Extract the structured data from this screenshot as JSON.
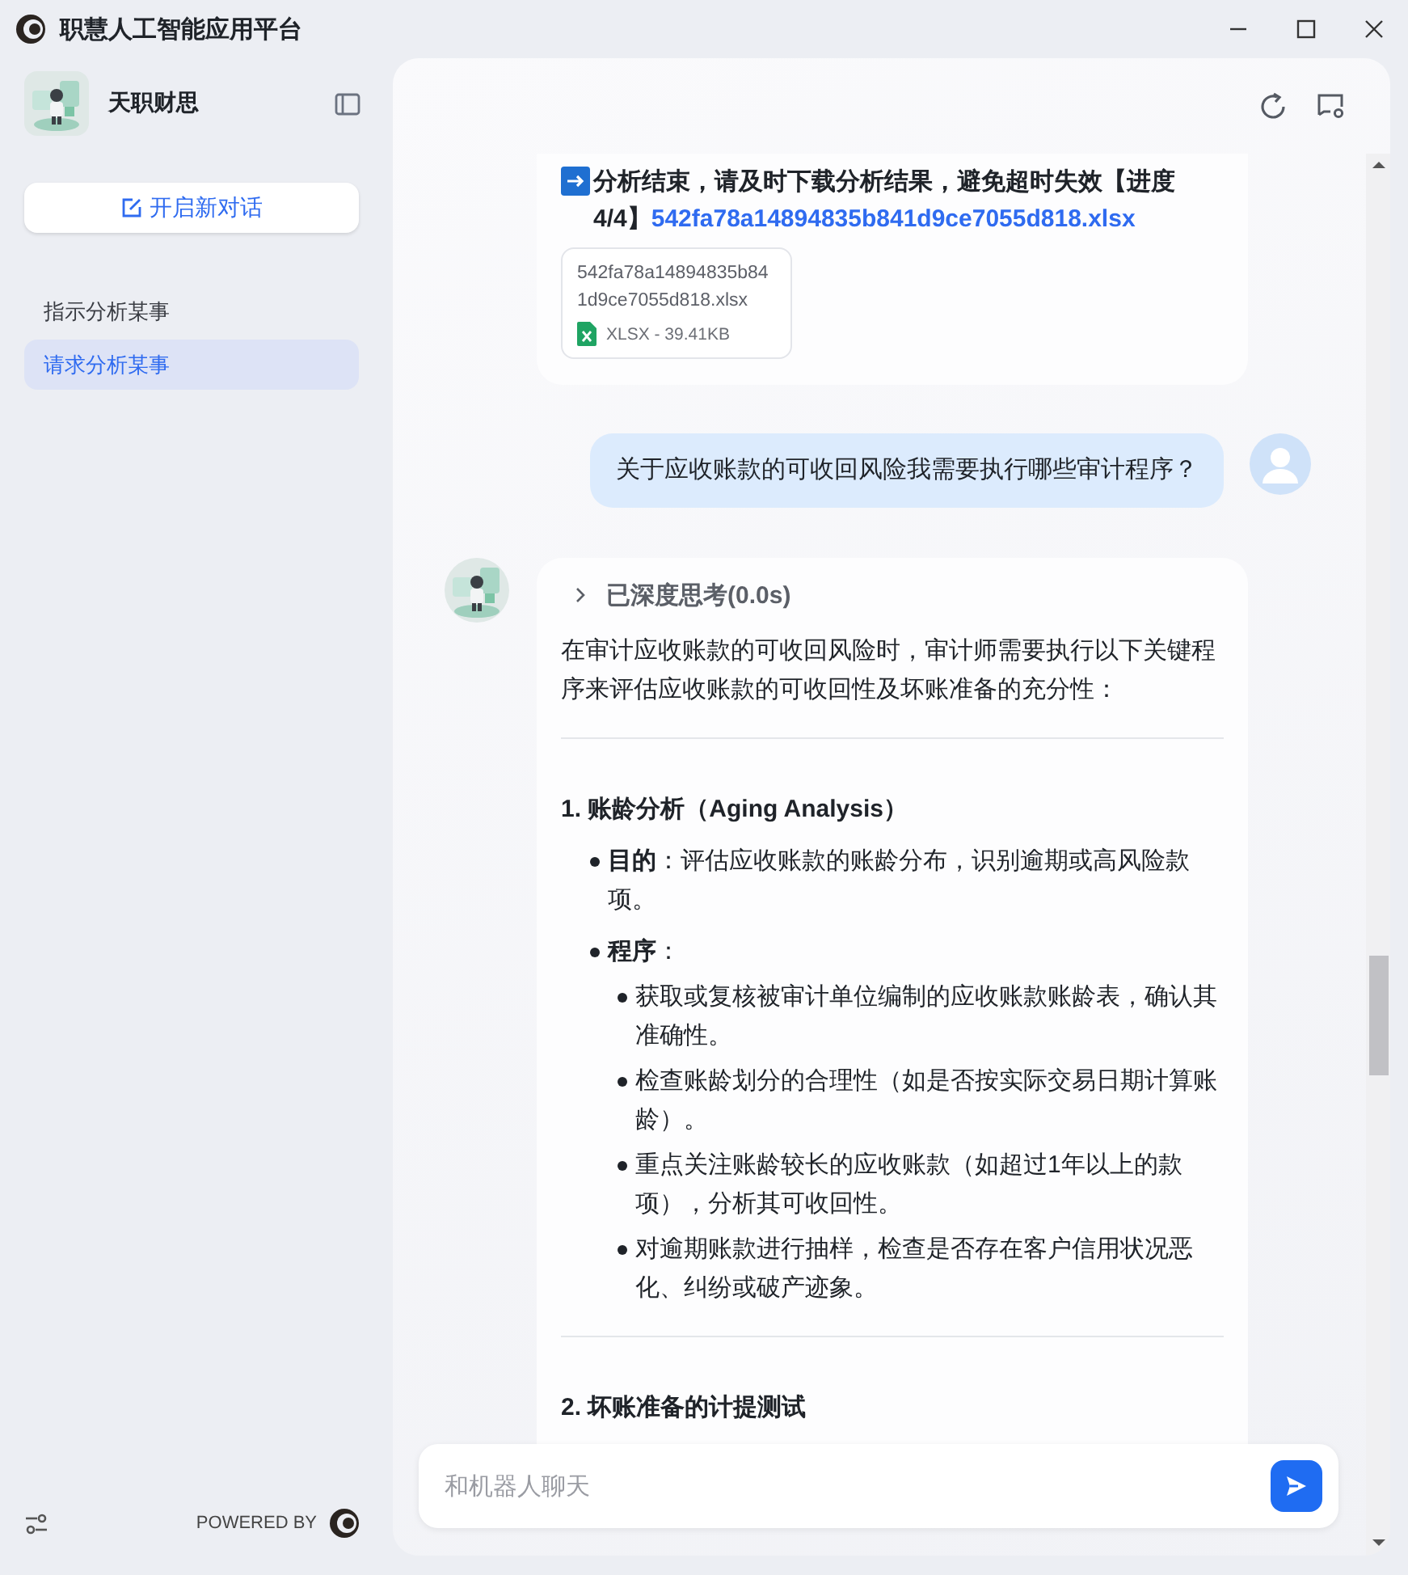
{
  "window": {
    "title": "职慧人工智能应用平台"
  },
  "sidebar": {
    "bot_name": "天职财思",
    "new_chat": "开启新对话",
    "conversations": [
      {
        "label": "指示分析某事",
        "selected": false
      },
      {
        "label": "请求分析某事",
        "selected": true
      }
    ],
    "powered_by": "POWERED BY"
  },
  "messages": [
    {
      "kind": "file_result",
      "text": "分析结束，请及时下载分析结果，避免超时失效【进度4/4】",
      "link": "542fa78a14894835b841d9ce7055d818.xlsx",
      "file": {
        "name": "542fa78a14894835b841d9ce7055d818.xlsx",
        "meta": "XLSX - 39.41KB"
      }
    },
    {
      "kind": "question",
      "text": "关于应收账款的可收回风险我需要执行哪些审计程序？"
    },
    {
      "kind": "answer",
      "thinking": {
        "label": "已深度思考(0.0s)",
        "expanded": false
      },
      "intro": "在审计应收账款的可收回风险时，审计师需要执行以下关键程序来评估应收账款的可收回性及坏账准备的充分性：",
      "sections": [
        {
          "heading": "1. 账龄分析（Aging Analysis）",
          "items": [
            {
              "text": "**目的**：评估应收账款的账龄分布，识别逾期或高风险款项。"
            },
            {
              "text": "**程序**：",
              "children": [
                "获取或复核被审计单位编制的应收账款账龄表，确认其准确性。",
                "检查账龄划分的合理性（如是否按实际交易日期计算账龄）。",
                "重点关注账龄较长的应收账款（如超过1年以上的款项），分析其可收回性。",
                "对逾期账款进行抽样，检查是否存在客户信用状况恶化、纠纷或破产迹象。"
              ]
            }
          ]
        },
        {
          "heading": "2. 坏账准备的计提测试"
        }
      ]
    }
  ],
  "input": {
    "placeholder": "和机器人聊天"
  }
}
